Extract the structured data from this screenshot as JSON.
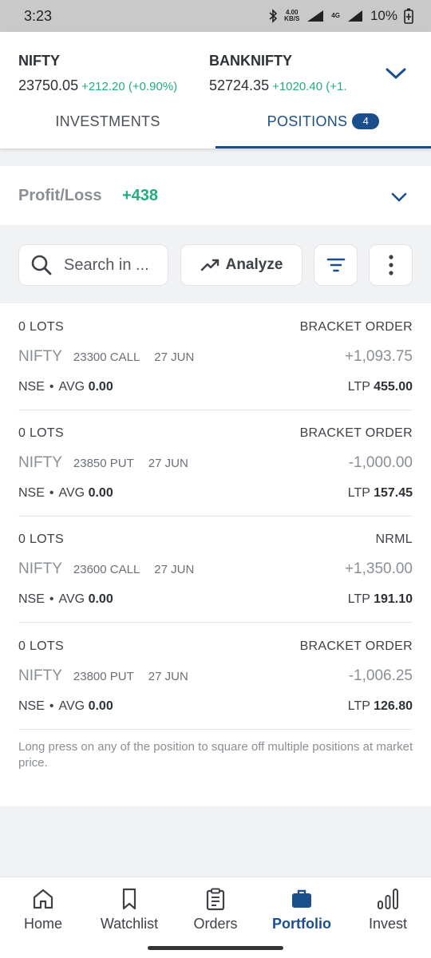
{
  "status": {
    "time": "3:23",
    "net_speed": "4.00",
    "net_unit": "KB/S",
    "net_type": "4G",
    "battery": "10%"
  },
  "indices": [
    {
      "name": "NIFTY",
      "value": "23750.05",
      "change": "+212.20 (+0.90%)"
    },
    {
      "name": "BANKNIFTY",
      "value": "52724.35",
      "change": "+1020.40 (+1."
    }
  ],
  "tabs": {
    "investments": "INVESTMENTS",
    "positions": "POSITIONS",
    "positions_count": "4"
  },
  "pl": {
    "label": "Profit/Loss",
    "amount": "+438"
  },
  "toolbar": {
    "search_placeholder": "Search in ...",
    "analyze_label": "Analyze"
  },
  "positions": [
    {
      "lots": "0 LOTS",
      "order_type": "BRACKET ORDER",
      "symbol": "NIFTY",
      "strike": "23300 CALL",
      "expiry": "27 JUN",
      "pnl": "+1,093.75",
      "exchange": "NSE",
      "avg_label": "AVG",
      "avg": "0.00",
      "ltp_label": "LTP",
      "ltp": "455.00"
    },
    {
      "lots": "0 LOTS",
      "order_type": "BRACKET ORDER",
      "symbol": "NIFTY",
      "strike": "23850 PUT",
      "expiry": "27 JUN",
      "pnl": "-1,000.00",
      "exchange": "NSE",
      "avg_label": "AVG",
      "avg": "0.00",
      "ltp_label": "LTP",
      "ltp": "157.45"
    },
    {
      "lots": "0 LOTS",
      "order_type": "NRML",
      "symbol": "NIFTY",
      "strike": "23600 CALL",
      "expiry": "27 JUN",
      "pnl": "+1,350.00",
      "exchange": "NSE",
      "avg_label": "AVG",
      "avg": "0.00",
      "ltp_label": "LTP",
      "ltp": "191.10"
    },
    {
      "lots": "0 LOTS",
      "order_type": "BRACKET ORDER",
      "symbol": "NIFTY",
      "strike": "23800 PUT",
      "expiry": "27 JUN",
      "pnl": "-1,006.25",
      "exchange": "NSE",
      "avg_label": "AVG",
      "avg": "0.00",
      "ltp_label": "LTP",
      "ltp": "126.80"
    }
  ],
  "note": "Long press on any of the position to square off multiple positions at market price.",
  "nav": {
    "home": "Home",
    "watchlist": "Watchlist",
    "orders": "Orders",
    "portfolio": "Portfolio",
    "invest": "Invest"
  },
  "colors": {
    "accent": "#1a4e8c",
    "positive": "#1fae7c",
    "muted": "#8a8f95"
  },
  "icons": [
    "bluetooth-icon",
    "signal-icon",
    "battery-icon",
    "chevron-down-icon",
    "search-icon",
    "trending-up-icon",
    "filter-icon",
    "more-vertical-icon",
    "home-icon",
    "bookmark-icon",
    "clipboard-icon",
    "briefcase-icon",
    "bar-chart-icon"
  ]
}
